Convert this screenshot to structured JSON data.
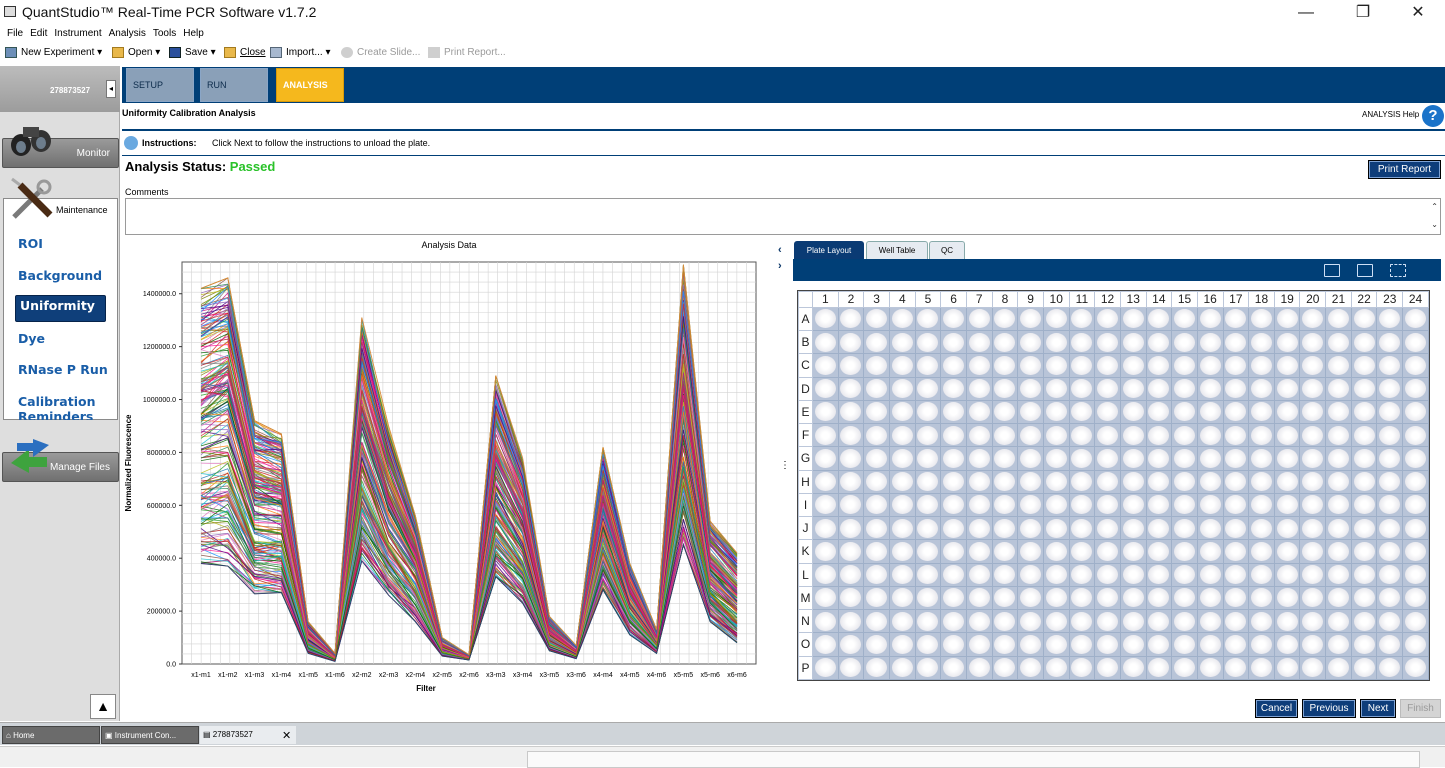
{
  "window": {
    "title": "QuantStudio™ Real-Time PCR Software v1.7.2",
    "min": "—",
    "max": "❐",
    "close": "✕"
  },
  "menu": [
    "File",
    "Edit",
    "Instrument",
    "Analysis",
    "Tools",
    "Help"
  ],
  "toolbar": {
    "new_experiment": "New Experiment ▾",
    "open": "Open ▾",
    "save": "Save ▾",
    "close": "Close",
    "import": "Import... ▾",
    "create_slide": "Create Slide...",
    "print_report": "Print Report..."
  },
  "sidebar": {
    "id": "278873527",
    "collapse": "◂",
    "monitor": "Monitor",
    "maintenance": "Maintenance",
    "items": [
      "ROI",
      "Background",
      "Uniformity",
      "Dye",
      "RNase P Run",
      "Calibration Reminders"
    ],
    "selected": "Uniformity",
    "manage_files": "Manage Files",
    "up": "▲"
  },
  "tabs": [
    {
      "label": "SETUP"
    },
    {
      "label": "RUN"
    },
    {
      "label": "ANALYSIS"
    }
  ],
  "page": {
    "title": "Uniformity Calibration Analysis",
    "help": "ANALYSIS Help",
    "help_symbol": "?",
    "instructions_label": "Instructions:",
    "instructions_text": "Click Next to follow the instructions to unload the plate.",
    "status_label": "Analysis Status:",
    "status_value": "Passed",
    "status_color": "#29c229",
    "print_report": "Print Report",
    "comments_label": "Comments"
  },
  "right_panel": {
    "tabs": [
      "Plate Layout",
      "Well Table",
      "QC"
    ],
    "active_tab": "Plate Layout",
    "columns": [
      "1",
      "2",
      "3",
      "4",
      "5",
      "6",
      "7",
      "8",
      "9",
      "10",
      "11",
      "12",
      "13",
      "14",
      "15",
      "16",
      "17",
      "18",
      "19",
      "20",
      "21",
      "22",
      "23",
      "24"
    ],
    "rows": [
      "A",
      "B",
      "C",
      "D",
      "E",
      "F",
      "G",
      "H",
      "I",
      "J",
      "K",
      "L",
      "M",
      "N",
      "O",
      "P"
    ]
  },
  "buttons": {
    "cancel": "Cancel",
    "previous": "Previous",
    "next": "Next",
    "finish": "Finish"
  },
  "taskbar": {
    "home": "Home",
    "instrument": "Instrument Con...",
    "experiment": "278873527",
    "close": "✕"
  },
  "chart_data": {
    "type": "line",
    "title": "Analysis Data",
    "xlabel": "Filter",
    "ylabel": "Normalized Fluorescence",
    "categories": [
      "x1-m1",
      "x1-m2",
      "x1-m3",
      "x1-m4",
      "x1-m5",
      "x1-m6",
      "x2-m2",
      "x2-m3",
      "x2-m4",
      "x2-m5",
      "x2-m6",
      "x3-m3",
      "x3-m4",
      "x3-m5",
      "x3-m6",
      "x4-m4",
      "x4-m5",
      "x4-m6",
      "x5-m5",
      "x5-m6",
      "x6-m6"
    ],
    "yticks": [
      0,
      200000,
      400000,
      600000,
      800000,
      1000000,
      1200000,
      1400000
    ],
    "ytick_labels": [
      "0.0",
      "200000.0",
      "400000.0",
      "600000.0",
      "800000.0",
      "1000000.0",
      "1200000.0",
      "1400000.0"
    ],
    "ylim": [
      0,
      1520000
    ],
    "grid": true,
    "n_series": 384,
    "series_envelope": {
      "min": [
        380000,
        370000,
        265000,
        270000,
        40000,
        10000,
        390000,
        260000,
        160000,
        30000,
        15000,
        330000,
        230000,
        50000,
        20000,
        280000,
        110000,
        40000,
        450000,
        160000,
        80000
      ],
      "median": [
        900000,
        950000,
        600000,
        580000,
        100000,
        25000,
        850000,
        560000,
        380000,
        60000,
        25000,
        650000,
        480000,
        100000,
        40000,
        560000,
        250000,
        90000,
        930000,
        330000,
        230000
      ],
      "max": [
        1420000,
        1460000,
        920000,
        870000,
        160000,
        40000,
        1310000,
        900000,
        560000,
        100000,
        35000,
        1090000,
        780000,
        180000,
        70000,
        820000,
        380000,
        130000,
        1510000,
        540000,
        420000
      ]
    }
  }
}
